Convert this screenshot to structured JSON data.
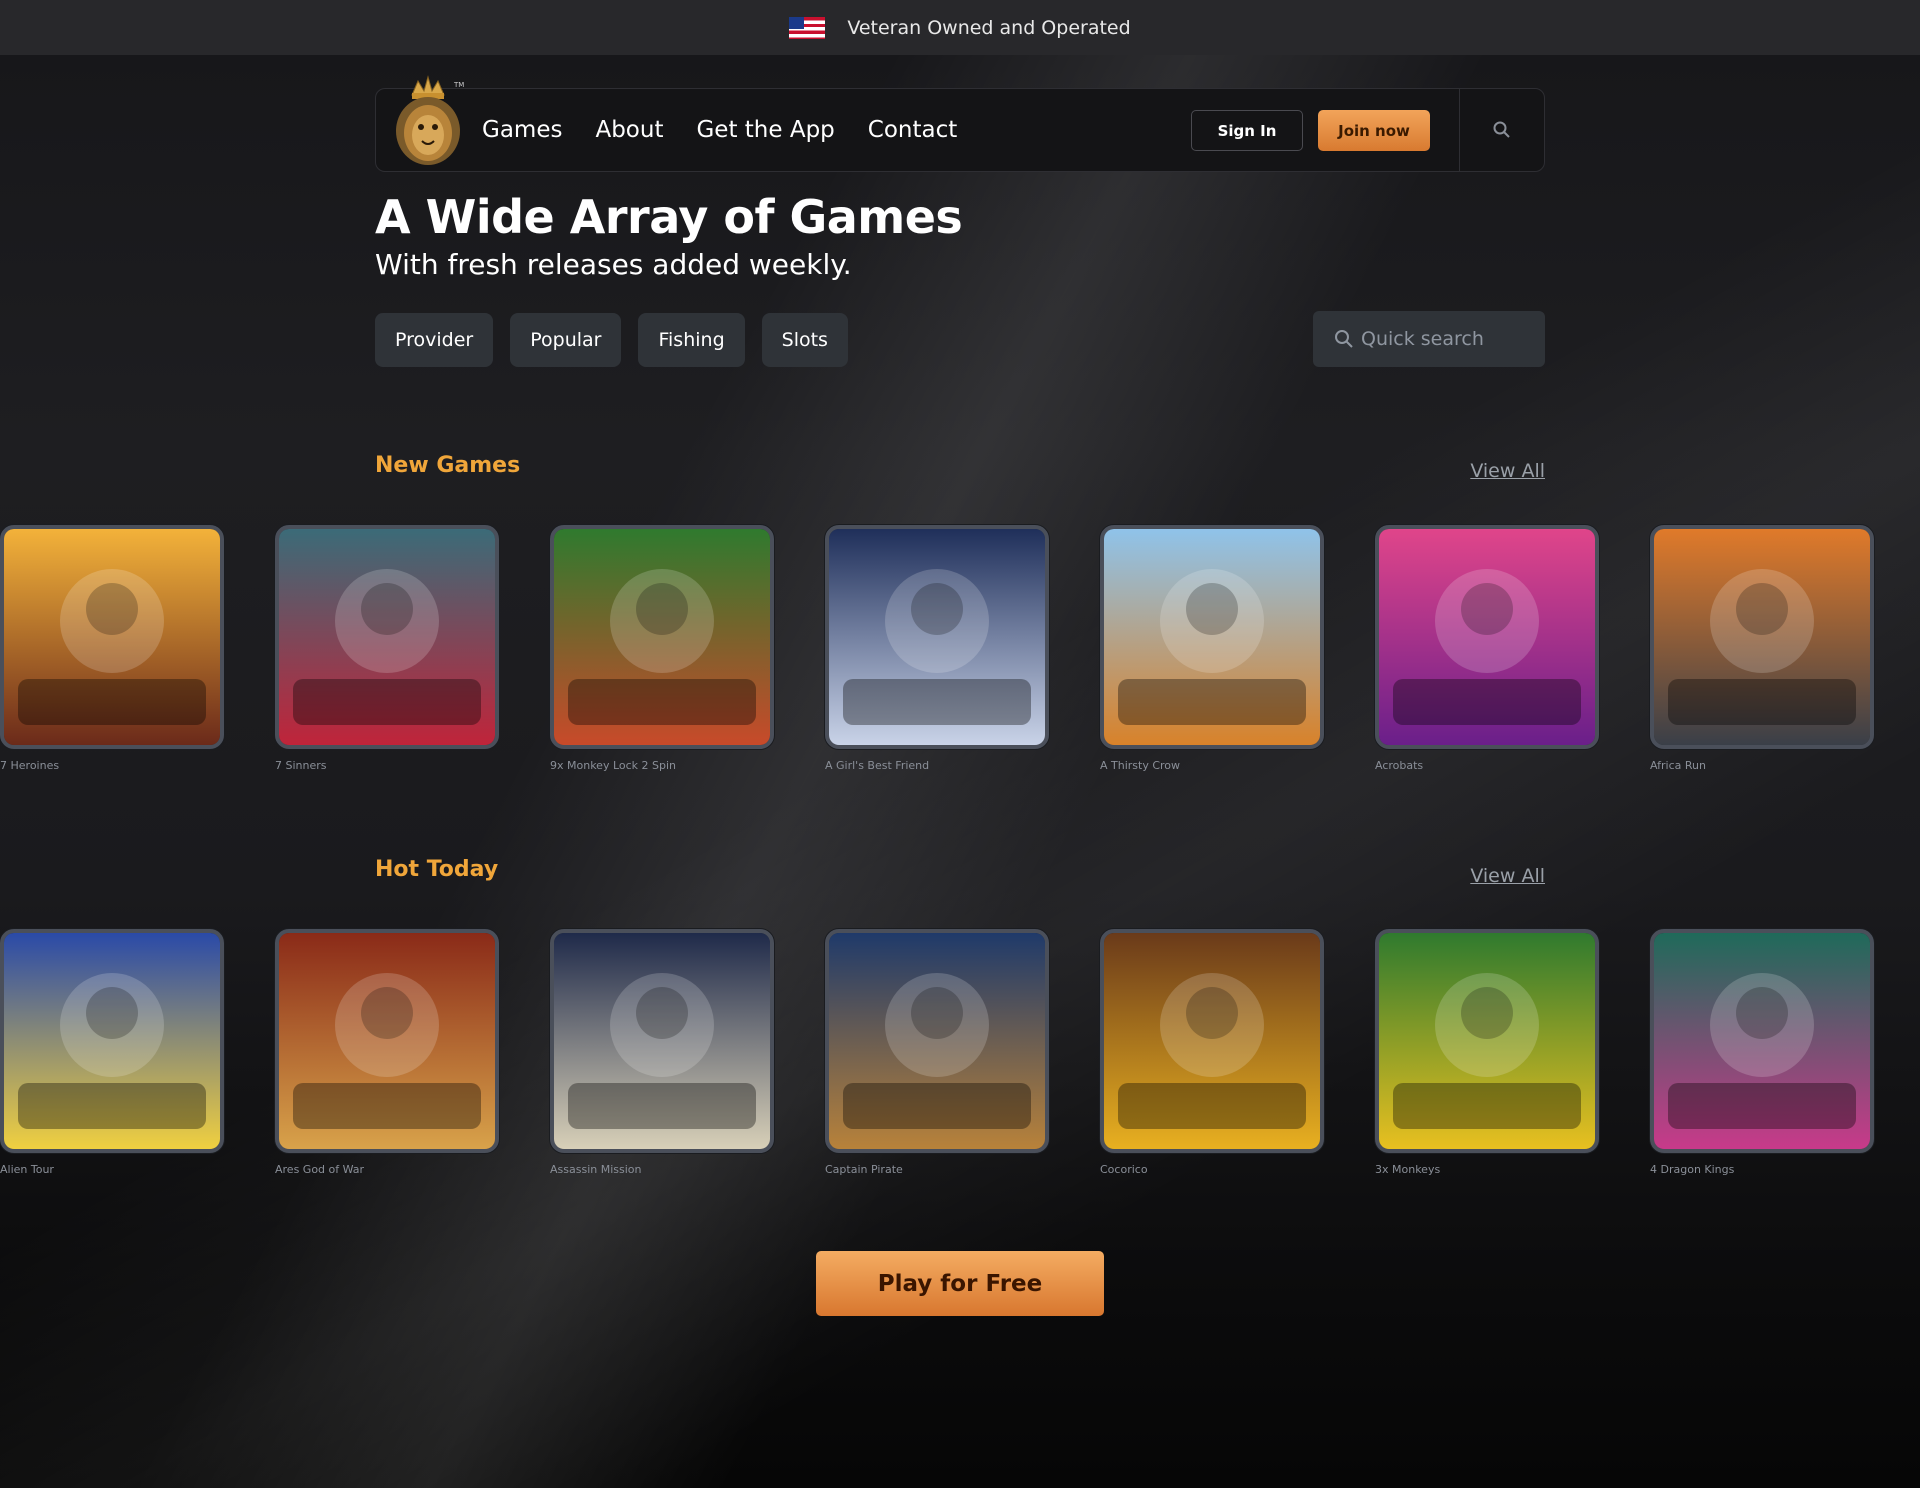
{
  "topbar": {
    "text": "Veteran Owned and Operated",
    "flag_icon": "us-flag-icon"
  },
  "nav": {
    "logo_icon": "lion-crown-logo",
    "links": [
      "Games",
      "About",
      "Get the App",
      "Contact"
    ],
    "signin_label": "Sign In",
    "join_label": "Join now",
    "search_icon": "search-icon"
  },
  "hero": {
    "title": "A Wide Array of Games",
    "subtitle": "With fresh releases added weekly."
  },
  "filters": [
    "Provider",
    "Popular",
    "Fishing",
    "Slots"
  ],
  "quick_search": {
    "placeholder": "Quick search"
  },
  "new_games": {
    "title": "New Games",
    "view_all": "View All",
    "items": [
      {
        "label": "7 Heroines",
        "colors": [
          "#f3b23a",
          "#6b2a1a"
        ]
      },
      {
        "label": "7 Sinners",
        "colors": [
          "#3b6b78",
          "#c0243a"
        ]
      },
      {
        "label": "9x Monkey Lock 2 Spin",
        "colors": [
          "#2f7a2e",
          "#c84a2a"
        ]
      },
      {
        "label": "A Girl's Best Friend",
        "colors": [
          "#1f2f5a",
          "#c9d3e8"
        ]
      },
      {
        "label": "A Thirsty Crow",
        "colors": [
          "#8fc3ea",
          "#d8822a"
        ]
      },
      {
        "label": "Acrobats",
        "colors": [
          "#e0458a",
          "#6a1f8a"
        ]
      },
      {
        "label": "Africa Run",
        "colors": [
          "#e07a2a",
          "#3a3f48"
        ]
      }
    ]
  },
  "hot_today": {
    "title": "Hot Today",
    "view_all": "View All",
    "items": [
      {
        "label": "Alien Tour",
        "colors": [
          "#2a4aa8",
          "#f0d040"
        ]
      },
      {
        "label": "Ares God of War",
        "colors": [
          "#8a2a18",
          "#d8a24a"
        ]
      },
      {
        "label": "Assassin Mission",
        "colors": [
          "#1f2a4a",
          "#d8d0b8"
        ]
      },
      {
        "label": "Captain Pirate",
        "colors": [
          "#1f3a6a",
          "#b8823a"
        ]
      },
      {
        "label": "Cocorico",
        "colors": [
          "#6a3a1a",
          "#e8b020"
        ]
      },
      {
        "label": "3x Monkeys",
        "colors": [
          "#2f7a2e",
          "#e8c020"
        ]
      },
      {
        "label": "4 Dragon Kings",
        "colors": [
          "#1f6a5a",
          "#c83a8a"
        ]
      }
    ]
  },
  "cta": {
    "label": "Play for Free"
  }
}
